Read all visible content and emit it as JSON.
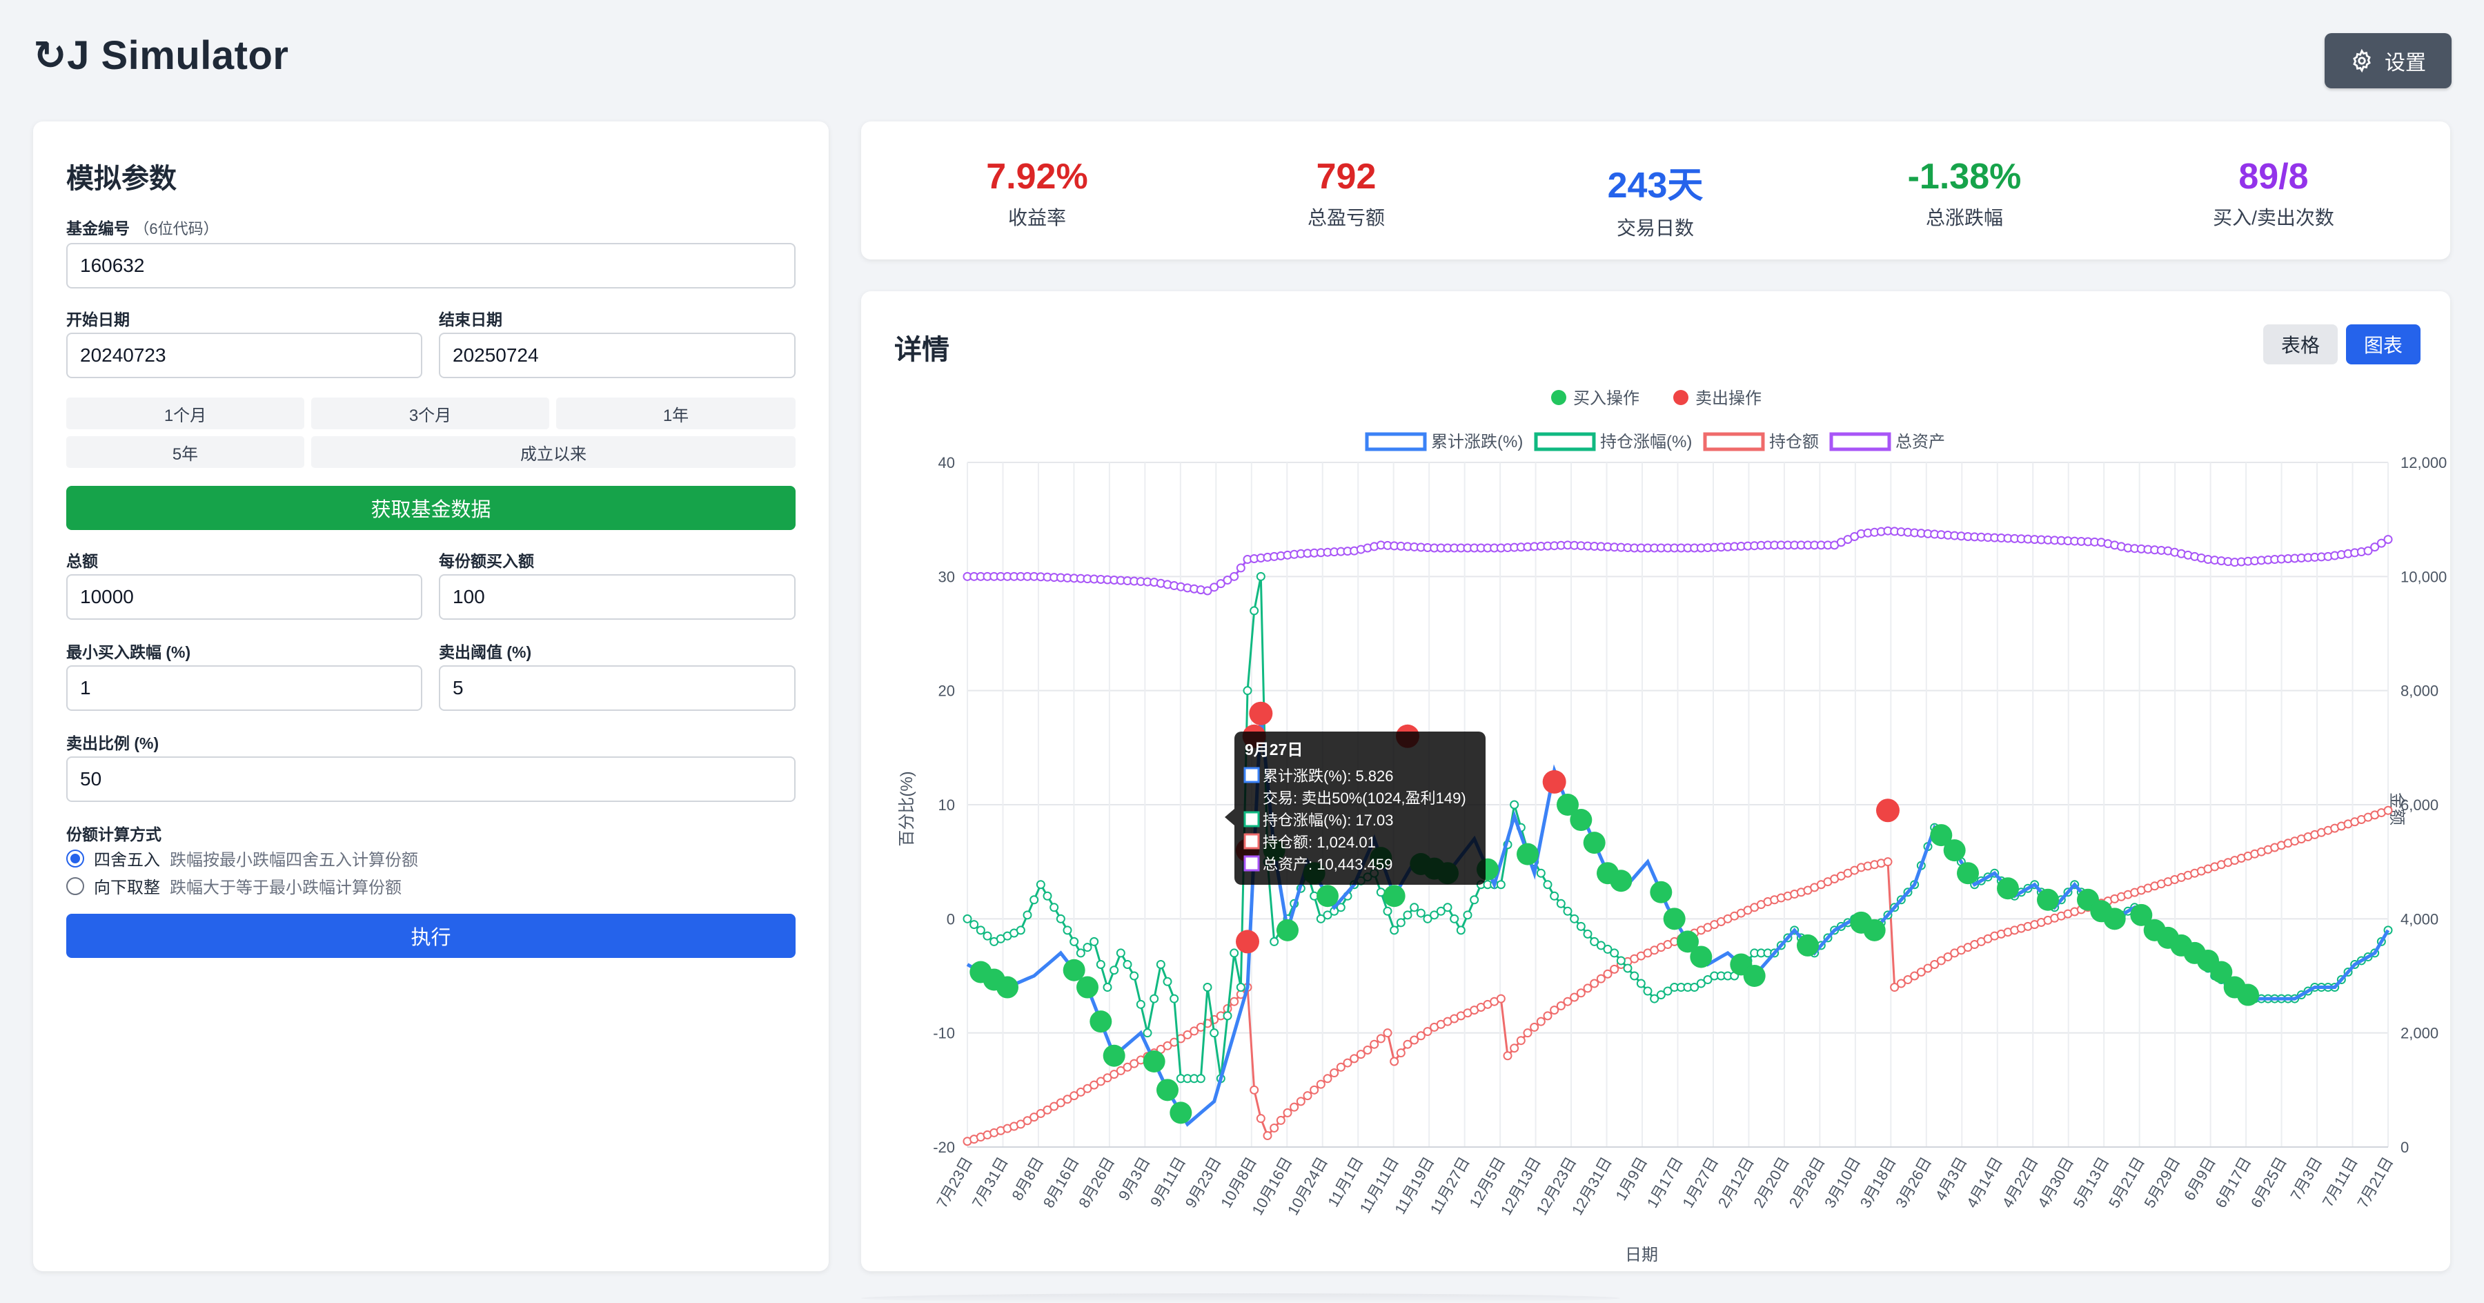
{
  "app": {
    "title": "↻J Simulator",
    "settings_label": "设置"
  },
  "params": {
    "heading": "模拟参数",
    "fund_code_label": "基金编号",
    "fund_code_hint": "（6位代码）",
    "fund_code": "160632",
    "start_label": "开始日期",
    "start_value": "20240723",
    "end_label": "结束日期",
    "end_value": "20250724",
    "ranges": [
      "1个月",
      "3个月",
      "1年",
      "5年",
      "成立以来"
    ],
    "fetch_label": "获取基金数据",
    "total_label": "总额",
    "total_value": "10000",
    "per_label": "每份额买入额",
    "per_value": "100",
    "min_drop_label": "最小买入跌幅 (%)",
    "min_drop_value": "1",
    "sell_threshold_label": "卖出阈值 (%)",
    "sell_threshold_value": "5",
    "sell_ratio_label": "卖出比例 (%)",
    "sell_ratio_value": "50",
    "method_label": "份额计算方式",
    "method_options": [
      {
        "name": "四舍五入",
        "desc": "跌幅按最小跌幅四舍五入计算份额",
        "selected": true
      },
      {
        "name": "向下取整",
        "desc": "跌幅大于等于最小跌幅计算份额",
        "selected": false
      }
    ],
    "run_label": "执行"
  },
  "stats": [
    {
      "value": "7.92%",
      "label": "收益率",
      "color": "#dc2626"
    },
    {
      "value": "792",
      "label": "总盈亏额",
      "color": "#dc2626"
    },
    {
      "value": "243天",
      "label": "交易日数",
      "color": "#2563eb"
    },
    {
      "value": "-1.38%",
      "label": "总涨跌幅",
      "color": "#16a34a"
    },
    {
      "value": "89/8",
      "label": "买入/卖出次数",
      "color": "#9333ea"
    }
  ],
  "detail": {
    "heading": "详情",
    "tab_table": "表格",
    "tab_chart": "图表",
    "active_tab": "图表"
  },
  "chart_data": {
    "type": "line",
    "legend_ops": [
      {
        "name": "买入操作",
        "color": "#22c55e"
      },
      {
        "name": "卖出操作",
        "color": "#ef4444"
      }
    ],
    "series": [
      {
        "name": "累计涨跌(%)",
        "color": "#3b82f6",
        "axis": "left"
      },
      {
        "name": "持仓涨幅(%)",
        "color": "#10b981",
        "axis": "left"
      },
      {
        "name": "持仓额",
        "color": "#ef6b6b",
        "axis": "right"
      },
      {
        "name": "总资产",
        "color": "#a855f7",
        "axis": "right"
      }
    ],
    "ylabel": "百分比(%)",
    "y2label": "金额",
    "xlabel": "日期",
    "ylim": [
      -20,
      40
    ],
    "y2lim": [
      0,
      12000
    ],
    "yticks": [
      "40",
      "30",
      "20",
      "10",
      "0",
      "-10",
      "-20"
    ],
    "y2ticks": [
      "12,000",
      "10,000",
      "8,000",
      "6,000",
      "4,000",
      "2,000",
      "0"
    ],
    "xticks": [
      "7月23日",
      "7月31日",
      "8月8日",
      "8月16日",
      "8月26日",
      "9月3日",
      "9月11日",
      "9月23日",
      "10月8日",
      "10月16日",
      "10月24日",
      "11月1日",
      "11月11日",
      "11月19日",
      "11月27日",
      "12月5日",
      "12月13日",
      "12月23日",
      "12月31日",
      "1月9日",
      "1月17日",
      "1月27日",
      "2月12日",
      "2月20日",
      "2月28日",
      "3月10日",
      "3月18日",
      "3月26日",
      "4月3日",
      "4月14日",
      "4月22日",
      "4月30日",
      "5月13日",
      "5月21日",
      "5月29日",
      "6月9日",
      "6月17日",
      "6月25日",
      "7月3日",
      "7月11日",
      "7月21日"
    ],
    "cumulative_knots": [
      [
        0,
        -4
      ],
      [
        3,
        -5
      ],
      [
        6,
        -6
      ],
      [
        10,
        -5
      ],
      [
        14,
        -3
      ],
      [
        18,
        -6
      ],
      [
        22,
        -12
      ],
      [
        26,
        -10
      ],
      [
        30,
        -15
      ],
      [
        33,
        -18
      ],
      [
        37,
        -16
      ],
      [
        40,
        -10
      ],
      [
        42,
        -6
      ],
      [
        44,
        18
      ],
      [
        46,
        6
      ],
      [
        48,
        -1
      ],
      [
        51,
        5
      ],
      [
        55,
        1
      ],
      [
        58,
        3
      ],
      [
        61,
        7
      ],
      [
        64,
        2
      ],
      [
        67,
        5
      ],
      [
        72,
        4
      ],
      [
        76,
        7
      ],
      [
        79,
        3
      ],
      [
        82,
        9
      ],
      [
        85,
        4
      ],
      [
        88,
        13
      ],
      [
        90,
        10
      ],
      [
        93,
        8
      ],
      [
        96,
        4
      ],
      [
        99,
        3
      ],
      [
        102,
        5
      ],
      [
        105,
        1
      ],
      [
        108,
        -2
      ],
      [
        111,
        -4
      ],
      [
        114,
        -3
      ],
      [
        118,
        -5
      ],
      [
        121,
        -3
      ],
      [
        124,
        -1
      ],
      [
        127,
        -3
      ],
      [
        130,
        -1
      ],
      [
        133,
        0
      ],
      [
        136,
        -1
      ],
      [
        139,
        1
      ],
      [
        142,
        3
      ],
      [
        145,
        8
      ],
      [
        148,
        6
      ],
      [
        151,
        3
      ],
      [
        154,
        4
      ],
      [
        157,
        2
      ],
      [
        160,
        3
      ],
      [
        163,
        1
      ],
      [
        166,
        3
      ],
      [
        169,
        1
      ],
      [
        172,
        0
      ],
      [
        175,
        1
      ],
      [
        178,
        -1
      ],
      [
        181,
        -2
      ],
      [
        184,
        -3
      ],
      [
        187,
        -4
      ],
      [
        190,
        -6
      ],
      [
        193,
        -7
      ],
      [
        196,
        -7
      ],
      [
        199,
        -7
      ],
      [
        202,
        -6
      ],
      [
        205,
        -6
      ],
      [
        208,
        -4
      ],
      [
        211,
        -3
      ],
      [
        213,
        -1
      ]
    ],
    "position_pct_knots": [
      [
        0,
        0
      ],
      [
        4,
        -2
      ],
      [
        8,
        -1
      ],
      [
        11,
        3
      ],
      [
        14,
        0
      ],
      [
        17,
        -3
      ],
      [
        19,
        -2
      ],
      [
        21,
        -6
      ],
      [
        23,
        -3
      ],
      [
        25,
        -5
      ],
      [
        27,
        -10
      ],
      [
        29,
        -4
      ],
      [
        31,
        -7
      ],
      [
        32,
        -14
      ],
      [
        35,
        -14
      ],
      [
        36,
        -6
      ],
      [
        38,
        -14
      ],
      [
        40,
        -3
      ],
      [
        41,
        -6
      ],
      [
        42,
        20
      ],
      [
        43,
        27
      ],
      [
        44,
        30
      ],
      [
        45,
        5
      ],
      [
        46,
        -2
      ],
      [
        48,
        0
      ],
      [
        51,
        4
      ],
      [
        53,
        0
      ],
      [
        56,
        1
      ],
      [
        58,
        3
      ],
      [
        61,
        4
      ],
      [
        64,
        -1
      ],
      [
        67,
        1
      ],
      [
        69,
        0
      ],
      [
        72,
        1
      ],
      [
        74,
        -1
      ],
      [
        77,
        3
      ],
      [
        80,
        3
      ],
      [
        82,
        10
      ],
      [
        84,
        6
      ],
      [
        86,
        4
      ],
      [
        88,
        2
      ],
      [
        91,
        0
      ],
      [
        94,
        -2
      ],
      [
        97,
        -3
      ],
      [
        100,
        -5
      ],
      [
        103,
        -7
      ],
      [
        106,
        -6
      ],
      [
        109,
        -6
      ],
      [
        112,
        -5
      ],
      [
        115,
        -5
      ],
      [
        118,
        -3
      ],
      [
        121,
        -3
      ],
      [
        124,
        -1
      ],
      [
        127,
        -3
      ],
      [
        130,
        -1
      ],
      [
        133,
        0
      ],
      [
        136,
        -1
      ],
      [
        139,
        1
      ],
      [
        142,
        3
      ],
      [
        145,
        8
      ],
      [
        148,
        6
      ],
      [
        151,
        3
      ],
      [
        154,
        4
      ],
      [
        157,
        2
      ],
      [
        160,
        3
      ],
      [
        163,
        1
      ],
      [
        166,
        3
      ],
      [
        169,
        1
      ],
      [
        172,
        0
      ],
      [
        175,
        1
      ],
      [
        178,
        -1
      ],
      [
        181,
        -2
      ],
      [
        184,
        -3
      ],
      [
        187,
        -5
      ],
      [
        190,
        -6
      ],
      [
        193,
        -7
      ],
      [
        196,
        -7
      ],
      [
        199,
        -7
      ],
      [
        202,
        -6
      ],
      [
        205,
        -6
      ],
      [
        208,
        -4
      ],
      [
        211,
        -3
      ],
      [
        213,
        -1
      ]
    ],
    "position_amount_knots": [
      [
        0,
        100
      ],
      [
        8,
        400
      ],
      [
        16,
        900
      ],
      [
        24,
        1400
      ],
      [
        32,
        1900
      ],
      [
        38,
        2300
      ],
      [
        42,
        2800
      ],
      [
        43,
        1000
      ],
      [
        44,
        500
      ],
      [
        45,
        200
      ],
      [
        48,
        600
      ],
      [
        52,
        1000
      ],
      [
        56,
        1400
      ],
      [
        60,
        1700
      ],
      [
        63,
        2000
      ],
      [
        64,
        1500
      ],
      [
        66,
        1800
      ],
      [
        70,
        2100
      ],
      [
        74,
        2300
      ],
      [
        78,
        2500
      ],
      [
        80,
        2600
      ],
      [
        81,
        1600
      ],
      [
        84,
        2000
      ],
      [
        88,
        2400
      ],
      [
        92,
        2700
      ],
      [
        98,
        3200
      ],
      [
        104,
        3500
      ],
      [
        110,
        3800
      ],
      [
        116,
        4100
      ],
      [
        120,
        4300
      ],
      [
        126,
        4500
      ],
      [
        130,
        4700
      ],
      [
        134,
        4900
      ],
      [
        138,
        5000
      ],
      [
        139,
        2800
      ],
      [
        142,
        3000
      ],
      [
        148,
        3400
      ],
      [
        154,
        3700
      ],
      [
        160,
        3900
      ],
      [
        168,
        4200
      ],
      [
        176,
        4500
      ],
      [
        184,
        4800
      ],
      [
        192,
        5100
      ],
      [
        200,
        5400
      ],
      [
        208,
        5700
      ],
      [
        213,
        5900
      ]
    ],
    "total_assets_knots": [
      [
        0,
        10000
      ],
      [
        10,
        10000
      ],
      [
        20,
        9950
      ],
      [
        28,
        9900
      ],
      [
        33,
        9800
      ],
      [
        36,
        9750
      ],
      [
        40,
        10000
      ],
      [
        42,
        10300
      ],
      [
        50,
        10400
      ],
      [
        58,
        10450
      ],
      [
        62,
        10550
      ],
      [
        70,
        10500
      ],
      [
        80,
        10500
      ],
      [
        90,
        10550
      ],
      [
        100,
        10500
      ],
      [
        110,
        10500
      ],
      [
        120,
        10550
      ],
      [
        130,
        10550
      ],
      [
        134,
        10750
      ],
      [
        138,
        10800
      ],
      [
        144,
        10750
      ],
      [
        150,
        10700
      ],
      [
        160,
        10650
      ],
      [
        170,
        10600
      ],
      [
        174,
        10500
      ],
      [
        180,
        10450
      ],
      [
        186,
        10300
      ],
      [
        190,
        10250
      ],
      [
        196,
        10300
      ],
      [
        204,
        10350
      ],
      [
        210,
        10450
      ],
      [
        213,
        10650
      ]
    ],
    "sell_ops": [
      [
        42,
        -2
      ],
      [
        42,
        6
      ],
      [
        43,
        16
      ],
      [
        44,
        18
      ],
      [
        66,
        16
      ],
      [
        88,
        12
      ],
      [
        138,
        9.5
      ]
    ],
    "tooltip": {
      "title": "9月27日",
      "lines": [
        "累计涨跌(%): 5.826",
        "交易: 卖出50%(1024,盈利149)",
        "持仓涨幅(%): 17.03",
        "持仓额: 1,024.01",
        "总资产: 10,443.459"
      ]
    }
  }
}
